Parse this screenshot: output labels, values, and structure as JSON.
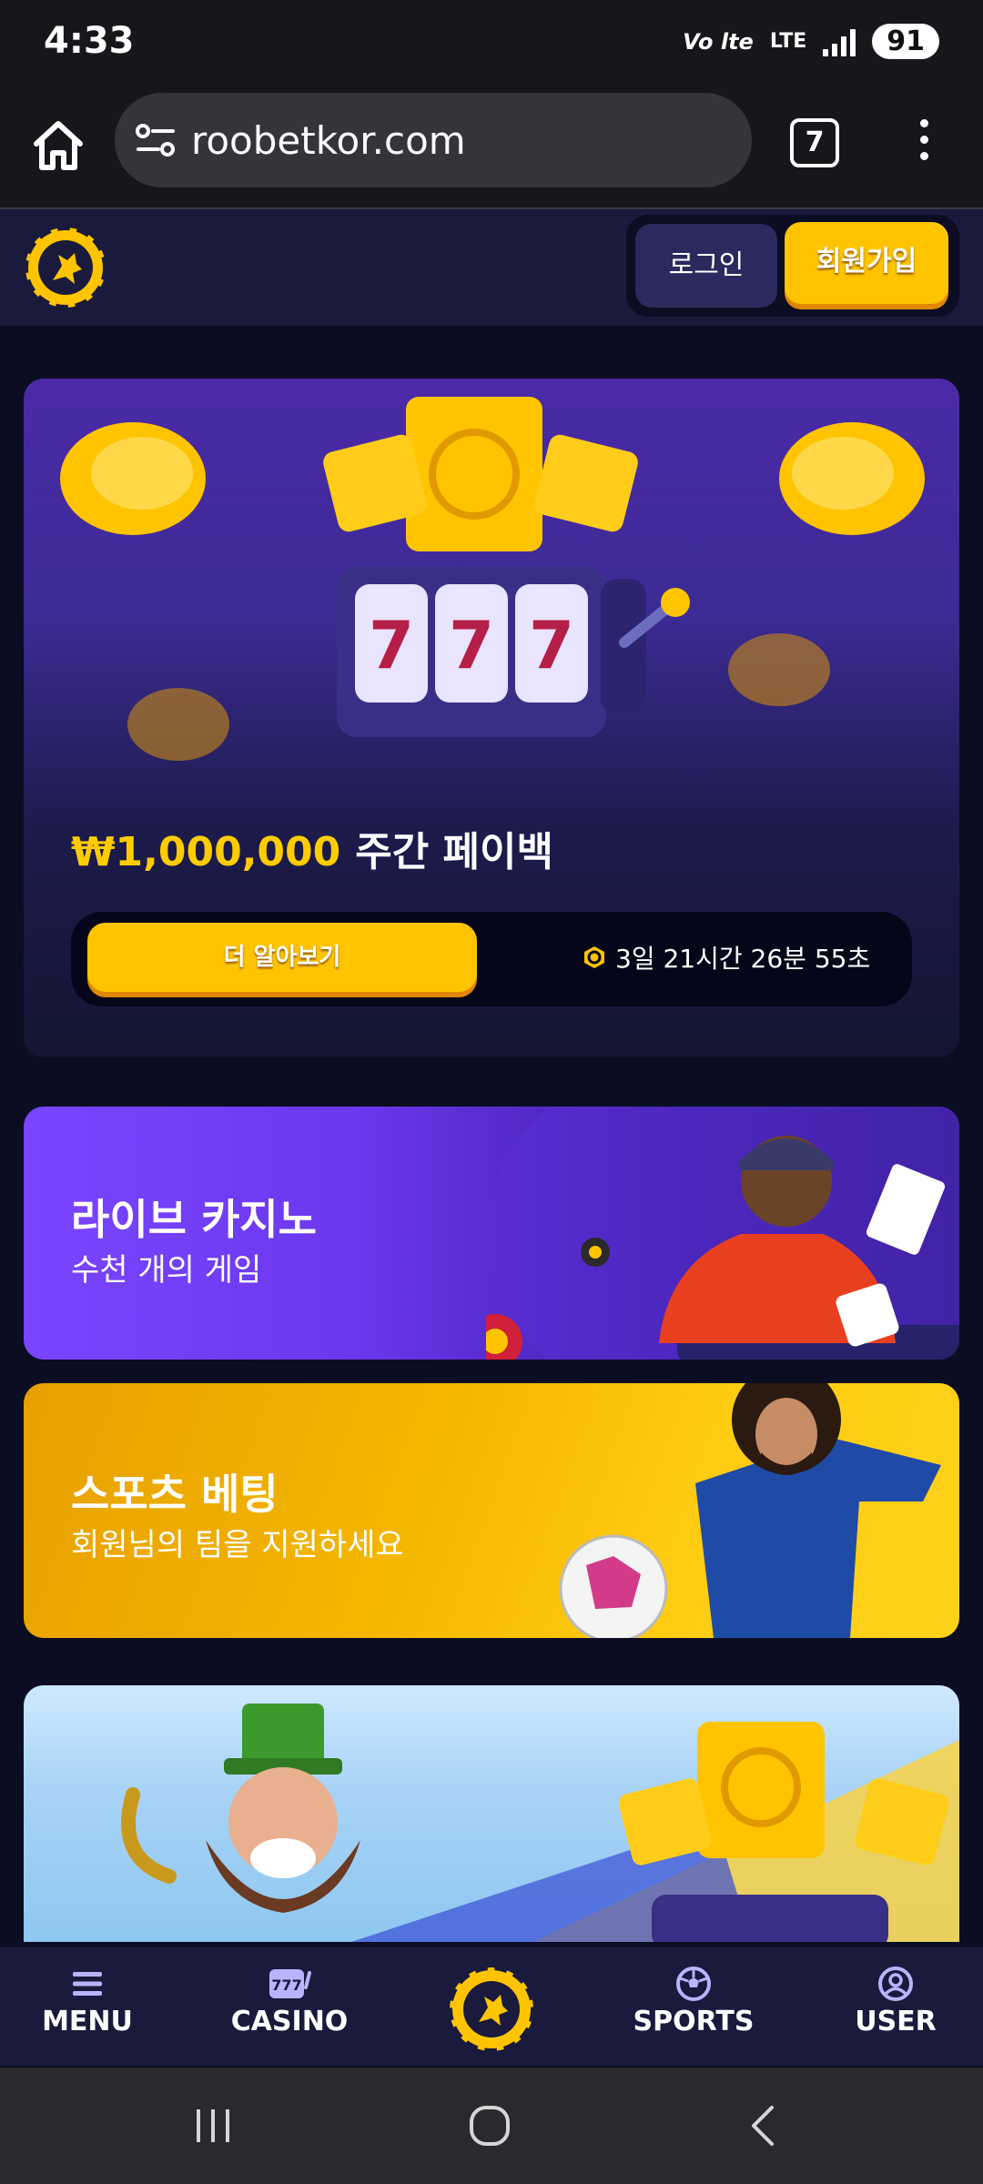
{
  "status_bar": {
    "time": "4:33",
    "volte": "Vo lte",
    "lte": "LTE",
    "battery": "91"
  },
  "browser": {
    "url": "roobetkor.com",
    "tab_count": "7"
  },
  "header": {
    "login_label": "로그인",
    "signup_label": "회원가입"
  },
  "promo": {
    "amount": "₩1,000,000",
    "title": "주간 페이백",
    "cta_label": "더 알아보기",
    "countdown": "3일 21시간 26분 55초"
  },
  "banners": [
    {
      "title": "라이브 카지노",
      "subtitle": "수천 개의 게임"
    },
    {
      "title": "스포츠 베팅",
      "subtitle": "회원님의 팀을 지원하세요"
    }
  ],
  "bottom_nav": {
    "items": [
      {
        "label": "MENU",
        "icon": "menu-icon"
      },
      {
        "label": "CASINO",
        "icon": "slot-machine-icon"
      },
      {
        "label": "SPORTS",
        "icon": "soccer-ball-icon"
      },
      {
        "label": "USER",
        "icon": "user-icon"
      }
    ]
  },
  "colors": {
    "accent": "#ffc400",
    "header_bg": "#191a3c",
    "page_bg": "#0b0d22"
  }
}
